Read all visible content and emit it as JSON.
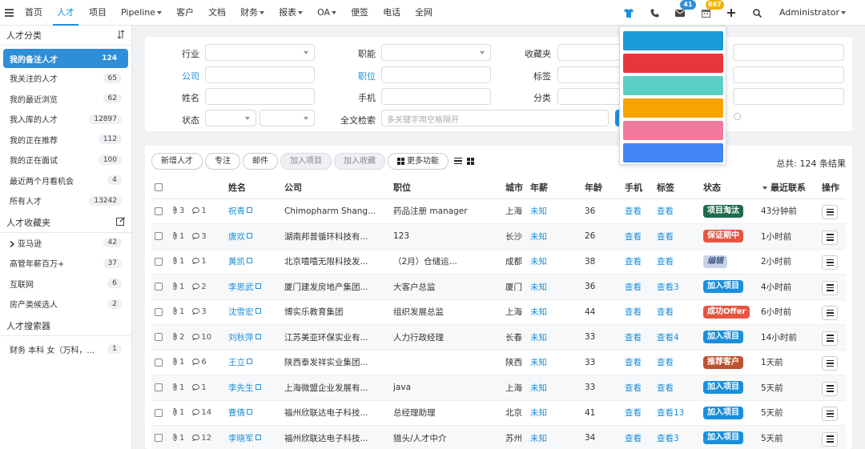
{
  "nav": {
    "items": [
      {
        "label": "首页",
        "active": false,
        "caret": false
      },
      {
        "label": "人才",
        "active": true,
        "caret": false
      },
      {
        "label": "项目",
        "active": false,
        "caret": false
      },
      {
        "label": "Pipeline",
        "active": false,
        "caret": true
      },
      {
        "label": "客户",
        "active": false,
        "caret": false
      },
      {
        "label": "文档",
        "active": false,
        "caret": false
      },
      {
        "label": "财务",
        "active": false,
        "caret": true
      },
      {
        "label": "报表",
        "active": false,
        "caret": true
      },
      {
        "label": "OA",
        "active": false,
        "caret": true
      },
      {
        "label": "便签",
        "active": false,
        "caret": false
      },
      {
        "label": "电话",
        "active": false,
        "caret": false
      },
      {
        "label": "全网",
        "active": false,
        "caret": false
      }
    ],
    "mail_badge": "41",
    "calendar_badge": "867",
    "user": "Administrator",
    "colors": {
      "accent": "#1a8fdc",
      "mail_badge": "#2f8ed8",
      "calendar_badge": "#f0b400"
    }
  },
  "sidebar": {
    "sections": [
      {
        "title": "人才分类",
        "icon": "sort-icon",
        "items": [
          {
            "label": "我的备注人才",
            "count": "124",
            "active": true
          },
          {
            "label": "我关注的人才",
            "count": "65"
          },
          {
            "label": "我的最近浏览",
            "count": "62"
          },
          {
            "label": "我入库的人才",
            "count": "12897"
          },
          {
            "label": "我的正在推荐",
            "count": "112"
          },
          {
            "label": "我的正在面试",
            "count": "100"
          },
          {
            "label": "最近两个月看机会",
            "count": "4"
          },
          {
            "label": "所有人才",
            "count": "13242"
          }
        ]
      },
      {
        "title": "人才收藏夹",
        "icon": "edit-icon",
        "items": [
          {
            "label": "亚马逊",
            "count": "42",
            "expander": true
          },
          {
            "label": "高管年薪百万+",
            "count": "37"
          },
          {
            "label": "互联网",
            "count": "6"
          },
          {
            "label": "房产类候选人",
            "count": "2"
          }
        ]
      },
      {
        "title": "人才搜索器",
        "icon": "",
        "items": [
          {
            "label": "财务 本科 女（万科，...",
            "count": "1"
          }
        ]
      }
    ]
  },
  "filter": {
    "industry": "行业",
    "company": "公司",
    "name": "姓名",
    "status": "状态",
    "function": "职能",
    "position": "职位",
    "phone": "手机",
    "fulltext": "全文检索",
    "fulltext_placeholder": "多关键字用空格隔开",
    "favorites": "收藏夹",
    "tags": "标签",
    "category": "分类"
  },
  "color_picker": {
    "swatches": [
      "#1a9ad6",
      "#e8373c",
      "#5ccfc4",
      "#f7a400",
      "#f27a9c",
      "#4285f4"
    ]
  },
  "toolbar": {
    "add_talent": "新增人才",
    "follow": "专注",
    "email": "邮件",
    "add_project": "加入项目",
    "add_favorite": "加入收藏",
    "more": "更多功能",
    "total": "总共: 124 条结果"
  },
  "table": {
    "headers": [
      "",
      "",
      "姓名",
      "公司",
      "职位",
      "城市",
      "年薪",
      "年龄",
      "手机",
      "标签",
      "状态",
      "最近联系",
      "操作"
    ],
    "rows": [
      {
        "attach": "3",
        "comments": "1",
        "name": "祝青",
        "company": "Chimopharm Shang...",
        "position": "药品注册 manager",
        "city": "上海",
        "salary": "未知",
        "age": "36",
        "phone": "查看",
        "tags": "查看",
        "status": "项目淘汰",
        "status_color": "#1f6b4a",
        "last": "43分钟前"
      },
      {
        "attach": "1",
        "comments": "3",
        "name": "唐欢",
        "company": "湖南邦普循环科技有...",
        "position": "123",
        "city": "长沙",
        "salary": "未知",
        "age": "26",
        "phone": "查看",
        "tags": "查看",
        "status": "保证期中",
        "status_color": "#e8553f",
        "last": "1小时前"
      },
      {
        "attach": "1",
        "comments": "1",
        "name": "黄凯",
        "company": "北京嘻嘻无限科技发...",
        "position": "（2月）仓储运...",
        "city": "成都",
        "salary": "未知",
        "age": "38",
        "phone": "查看",
        "tags": "查看",
        "status": "编辑",
        "status_color": "#c9d2e8",
        "last": "2小时前",
        "status_italic": true
      },
      {
        "attach": "1",
        "comments": "2",
        "name": "李思武",
        "company": "厦门建发房地产集团...",
        "position": "大客户总监",
        "city": "厦门",
        "salary": "未知",
        "age": "36",
        "phone": "查看",
        "tags": "查看3",
        "status": "加入项目",
        "status_color": "#1a8fdc",
        "last": "4小时前"
      },
      {
        "attach": "1",
        "comments": "3",
        "name": "沈雪宏",
        "company": "博实乐教育集团",
        "position": "组织发展总监",
        "city": "上海",
        "salary": "未知",
        "age": "44",
        "phone": "查看",
        "tags": "查看",
        "status": "成功Offer",
        "status_color": "#e8553f",
        "last": "6小时前"
      },
      {
        "attach": "2",
        "comments": "10",
        "name": "刘秋萍",
        "company": "江苏美亚环保实业有...",
        "position": "人力行政经理",
        "city": "长春",
        "salary": "未知",
        "age": "33",
        "phone": "查看",
        "tags": "查看4",
        "status": "加入项目",
        "status_color": "#1a8fdc",
        "last": "14小时前"
      },
      {
        "attach": "1",
        "comments": "6",
        "name": "王立",
        "company": "陕西泰发祥实业集团...",
        "position": "",
        "city": "陕西",
        "salary": "未知",
        "age": "33",
        "phone": "查看",
        "tags": "查看",
        "status": "推荐客户",
        "status_color": "#c0502f",
        "last": "1天前"
      },
      {
        "attach": "1",
        "comments": "1",
        "name": "李先生",
        "company": "上海微盟企业发展有...",
        "position": "java",
        "city": "上海",
        "salary": "未知",
        "age": "33",
        "phone": "查看",
        "tags": "查看",
        "status": "加入项目",
        "status_color": "#1a8fdc",
        "last": "5天前"
      },
      {
        "attach": "1",
        "comments": "14",
        "name": "曹倩",
        "company": "福州欣联达电子科技...",
        "position": "总经理助理",
        "city": "北京",
        "salary": "未知",
        "age": "41",
        "phone": "查看",
        "tags": "查看13",
        "status": "加入项目",
        "status_color": "#1a8fdc",
        "last": "5天前"
      },
      {
        "attach": "1",
        "comments": "12",
        "name": "李晓军",
        "company": "福州欣联达电子科技...",
        "position": "猎头/人才中介",
        "city": "苏州",
        "salary": "未知",
        "age": "34",
        "phone": "查看",
        "tags": "查看3",
        "status": "加入项目",
        "status_color": "#1a8fdc",
        "last": "5天前"
      }
    ]
  }
}
